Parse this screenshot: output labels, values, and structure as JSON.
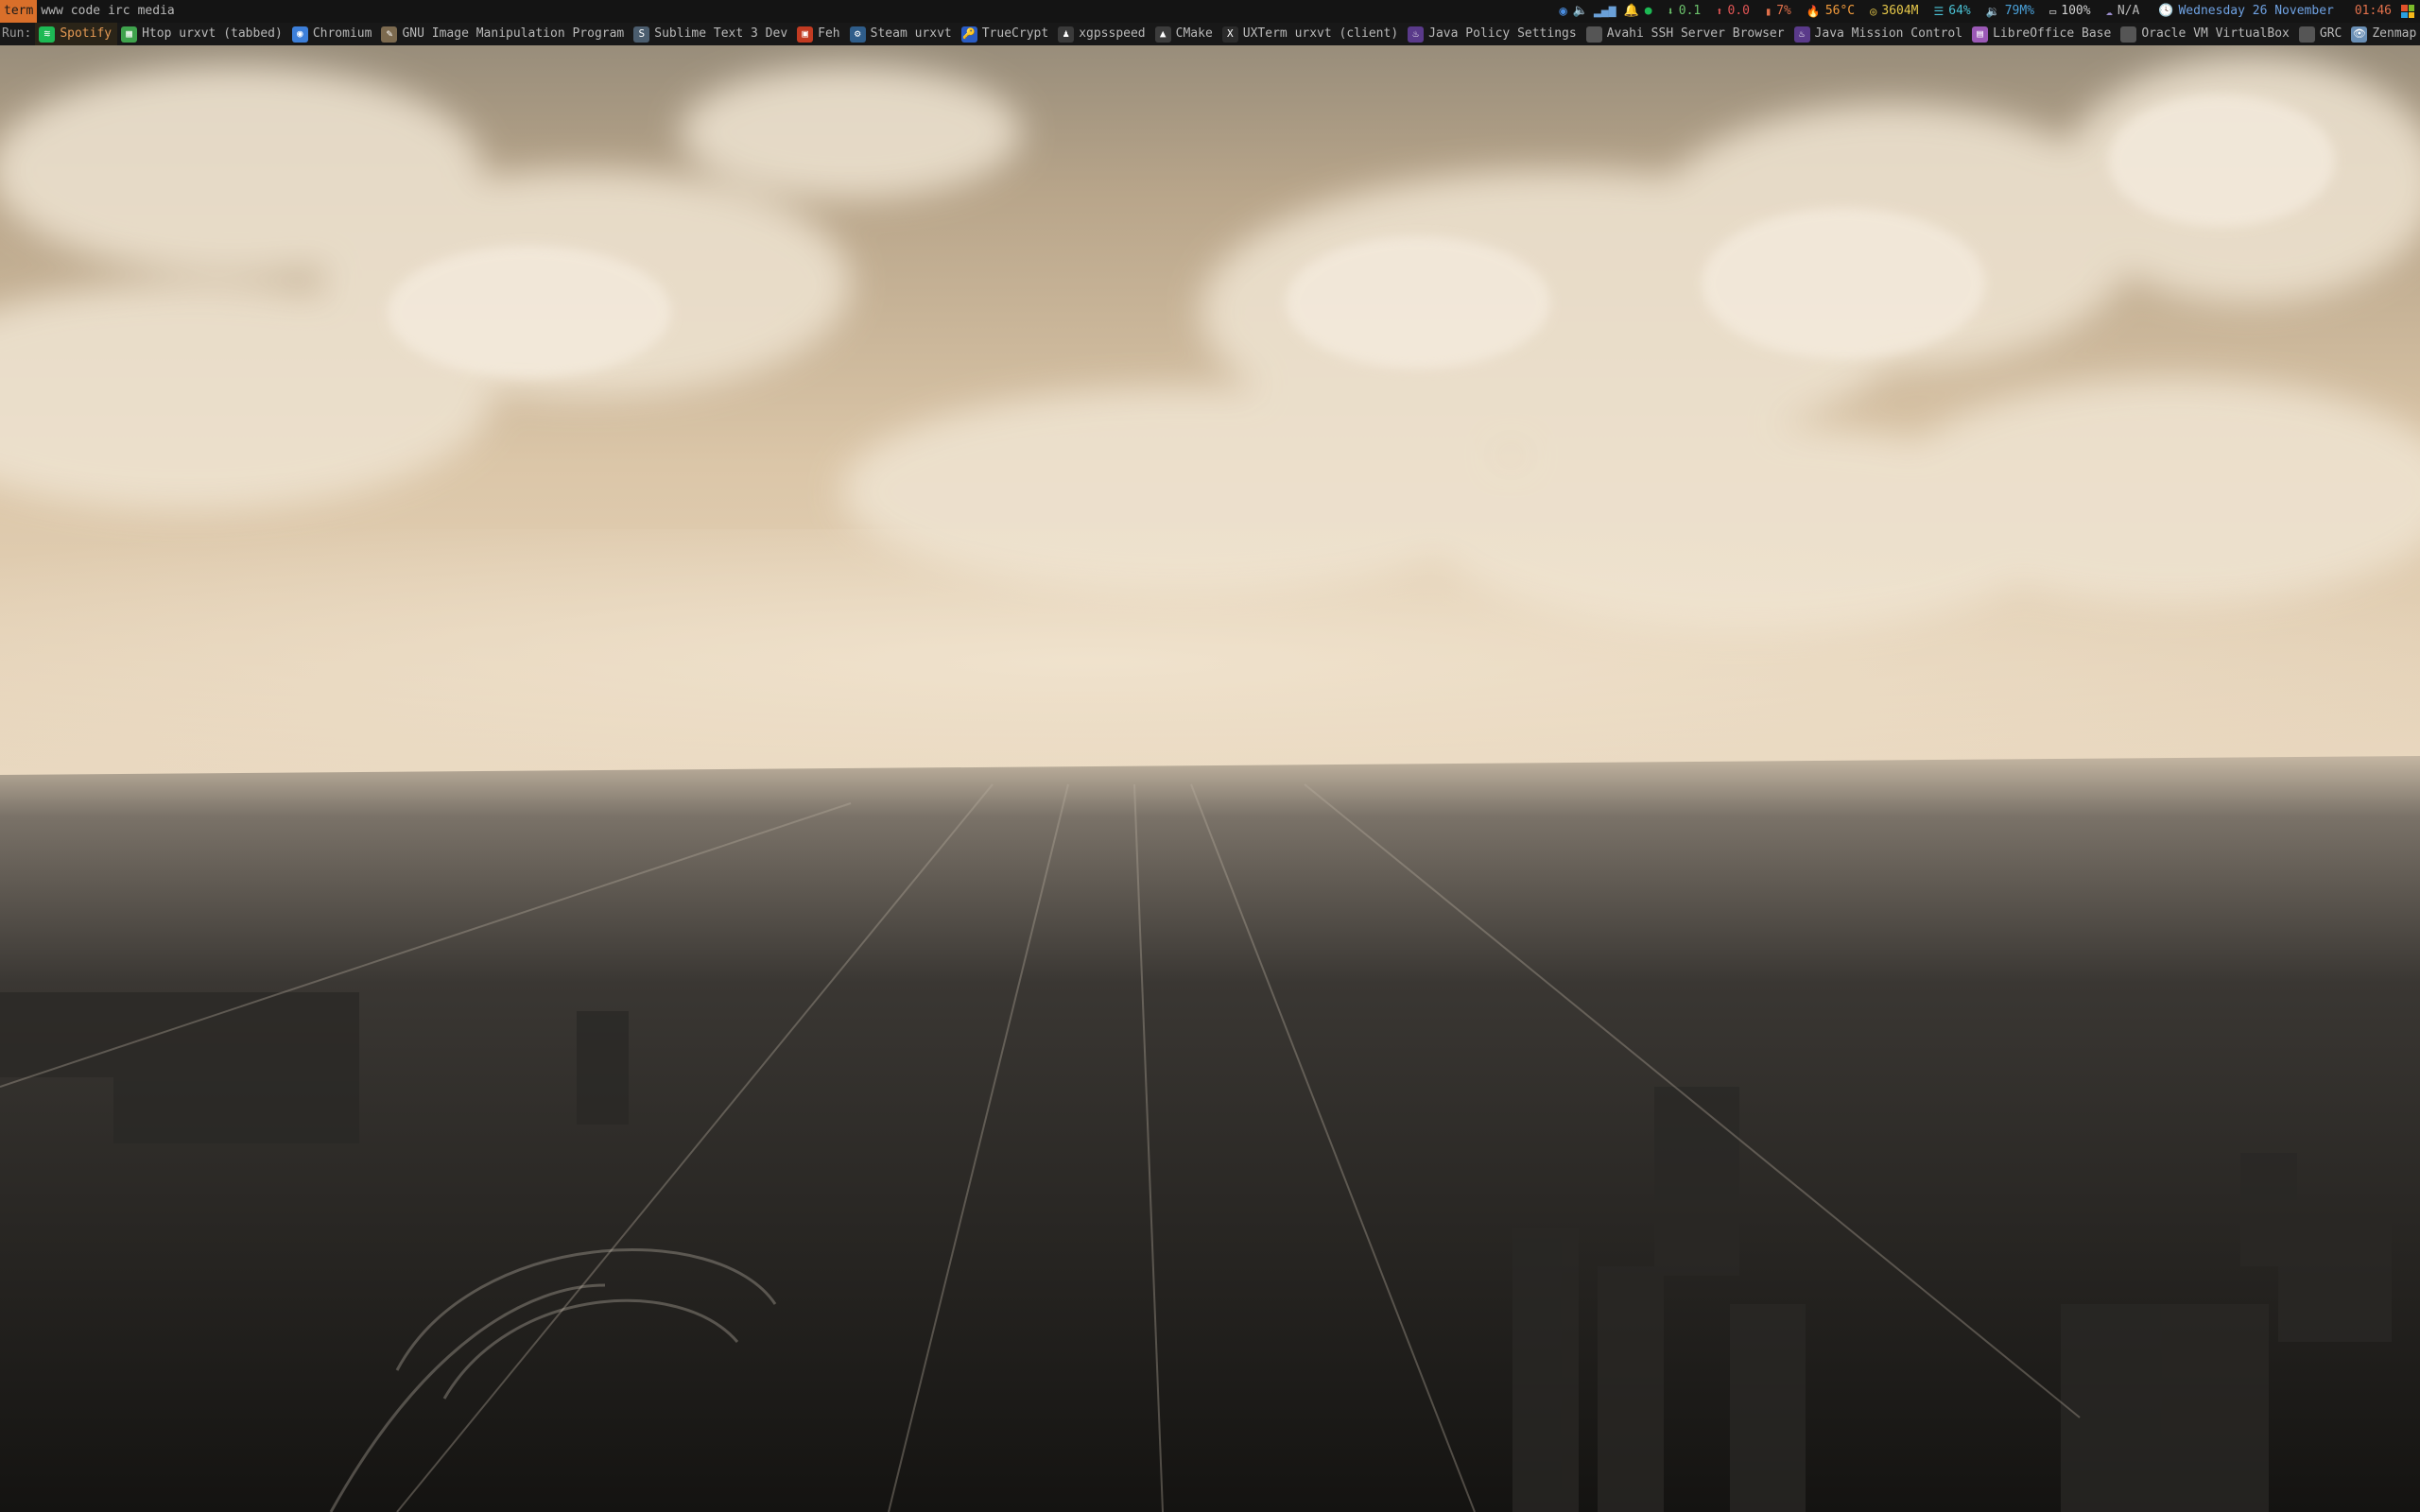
{
  "topbar": {
    "workspaces": [
      {
        "label": "term",
        "active": true
      },
      {
        "label": "www",
        "active": false
      },
      {
        "label": "code",
        "active": false
      },
      {
        "label": "irc",
        "active": false
      },
      {
        "label": "media",
        "active": false
      }
    ],
    "status": {
      "network_down": "0.1",
      "network_up": "0.0",
      "cpu": "7%",
      "temperature": "56°C",
      "memory": "3604M",
      "disk": "64%",
      "volume": "79M%",
      "battery": "100%",
      "weather": "N/A",
      "date": "Wednesday 26 November",
      "time": "01:46"
    }
  },
  "runbar": {
    "label": "Run:",
    "apps": [
      {
        "label": "Spotify",
        "icon": "spotify-icon",
        "color": "#1db954",
        "glyph": "≋",
        "active": true
      },
      {
        "label": "Htop urxvt (tabbed)",
        "icon": "terminal-grid-icon",
        "color": "#3fa34d",
        "glyph": "▦",
        "active": false
      },
      {
        "label": "Chromium",
        "icon": "chromium-icon",
        "color": "#3d7fd9",
        "glyph": "◉",
        "active": false
      },
      {
        "label": "GNU Image Manipulation Program",
        "icon": "gimp-icon",
        "color": "#7c6a4f",
        "glyph": "✎",
        "active": false
      },
      {
        "label": "Sublime Text 3 Dev",
        "icon": "sublime-text-icon",
        "color": "#4b5d6e",
        "glyph": "S",
        "active": false
      },
      {
        "label": "Feh",
        "icon": "feh-icon",
        "color": "#c23b22",
        "glyph": "▣",
        "active": false
      },
      {
        "label": "Steam urxvt",
        "icon": "steam-icon",
        "color": "#2f5d8a",
        "glyph": "⚙",
        "active": false
      },
      {
        "label": "TrueCrypt",
        "icon": "truecrypt-icon",
        "color": "#2a5cc4",
        "glyph": "🔑",
        "active": false
      },
      {
        "label": "xgpsspeed",
        "icon": "penguin-icon",
        "color": "#3a3a3a",
        "glyph": "♟",
        "active": false
      },
      {
        "label": "CMake",
        "icon": "cmake-icon",
        "color": "#3c3c3c",
        "glyph": "▲",
        "active": false
      },
      {
        "label": "UXTerm urxvt (client)",
        "icon": "xterm-icon",
        "color": "#2b2b2b",
        "glyph": "X",
        "active": false
      },
      {
        "label": "Java Policy Settings",
        "icon": "java-icon",
        "color": "#5a3a8a",
        "glyph": "♨",
        "active": false
      },
      {
        "label": "Avahi SSH Server Browser",
        "icon": "ssh-browser-icon",
        "color": "#555555",
        "glyph": "",
        "active": false
      },
      {
        "label": "Java Mission Control",
        "icon": "java-mission-icon",
        "color": "#5a3a8a",
        "glyph": "♨",
        "active": false
      },
      {
        "label": "LibreOffice Base",
        "icon": "libreoffice-base-icon",
        "color": "#9b59b6",
        "glyph": "▤",
        "active": false
      },
      {
        "label": "Oracle VM VirtualBox",
        "icon": "virtualbox-icon",
        "color": "#555555",
        "glyph": "",
        "active": false
      },
      {
        "label": "GRC",
        "icon": "grc-icon",
        "color": "#555555",
        "glyph": "",
        "active": false
      },
      {
        "label": "Zenmap",
        "icon": "zenmap-icon",
        "color": "#6a8fb5",
        "glyph": "👁",
        "active": false
      }
    ]
  },
  "colors": {
    "accent": "#d96f2a",
    "date": "#6fa2e3",
    "time": "#e0704b",
    "active_app": "#e59a54"
  }
}
